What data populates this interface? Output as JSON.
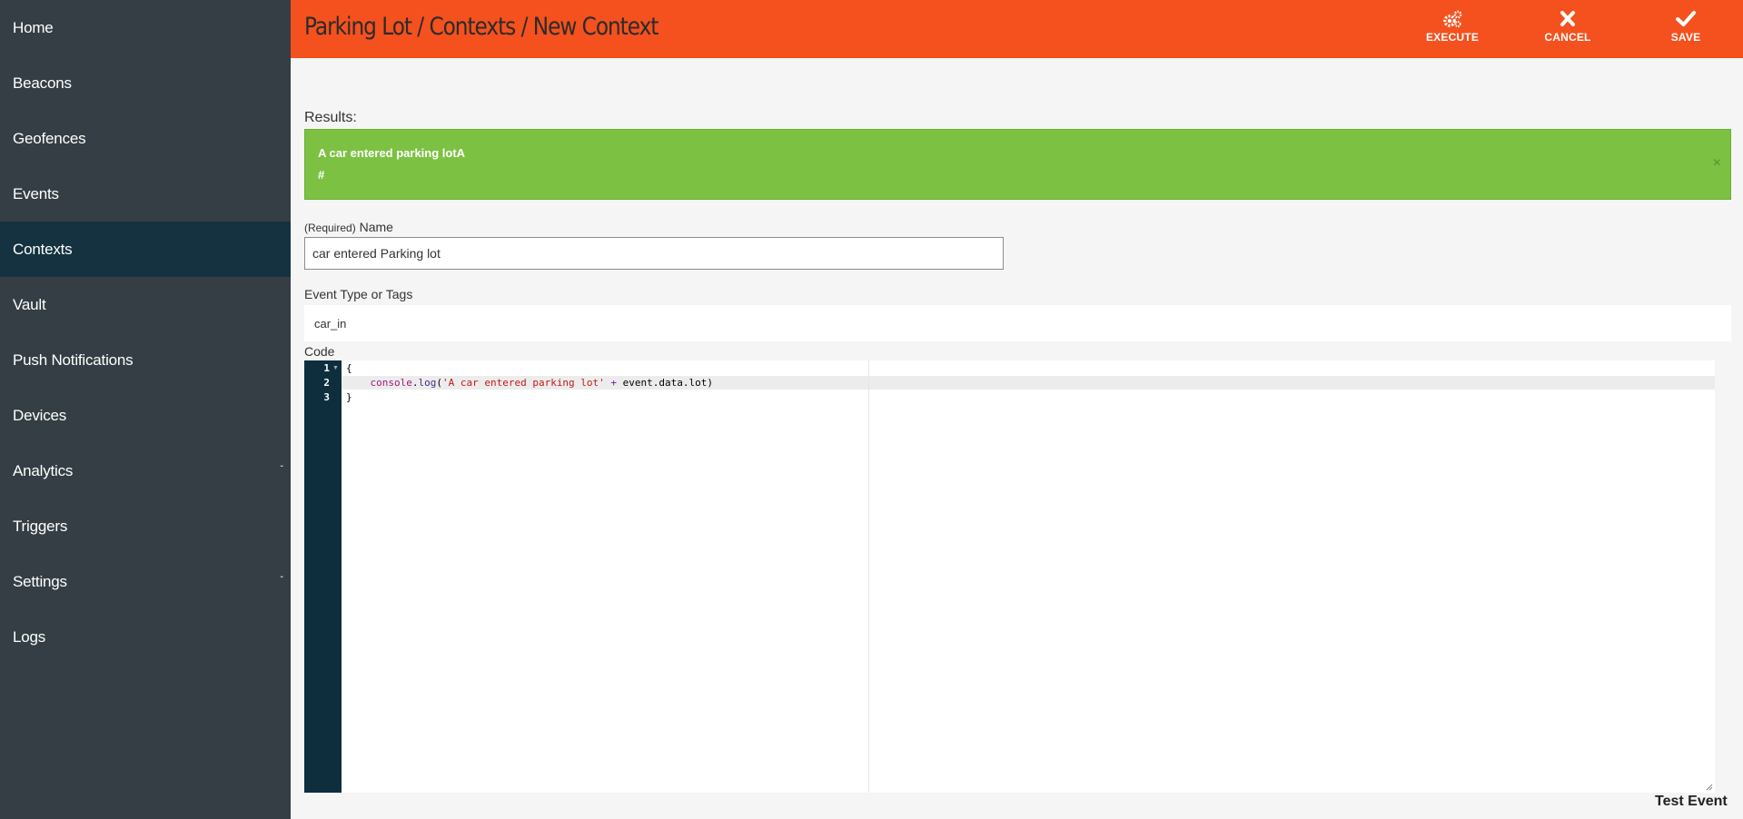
{
  "sidebar": {
    "items": [
      {
        "label": "Home"
      },
      {
        "label": "Beacons"
      },
      {
        "label": "Geofences"
      },
      {
        "label": "Events"
      },
      {
        "label": "Contexts",
        "active": true
      },
      {
        "label": "Vault"
      },
      {
        "label": "Push Notifications"
      },
      {
        "label": "Devices"
      },
      {
        "label": "Analytics",
        "expandable": true
      },
      {
        "label": "Triggers"
      },
      {
        "label": "Settings",
        "expandable": true
      },
      {
        "label": "Logs"
      }
    ]
  },
  "header": {
    "breadcrumb": "Parking Lot / Contexts / New Context",
    "background": "#f4511e",
    "actions": {
      "execute": {
        "label": "EXECUTE",
        "icon": "gears-icon"
      },
      "cancel": {
        "label": "CANCEL",
        "icon": "close-icon"
      },
      "save": {
        "label": "SAVE",
        "icon": "check-icon"
      }
    }
  },
  "results": {
    "label": "Results:",
    "line1": "A car entered parking lotA",
    "line2": "#",
    "close": "×",
    "color": "#7dc142"
  },
  "form": {
    "name_required": "(Required)",
    "name_label": "Name",
    "name_value": "car entered Parking lot",
    "tags_label": "Event Type or Tags",
    "tags_value": "car_in",
    "code_label": "Code"
  },
  "code": {
    "line_numbers": [
      "1",
      "2",
      "3"
    ],
    "line1": "{",
    "line2": {
      "indent": "    ",
      "obj": "console",
      "dot": ".",
      "fn": "log",
      "open": "(",
      "str": "'A car entered parking lot'",
      "op": " + ",
      "rest": "event.data.lot",
      "close": ")"
    },
    "line3": "}"
  },
  "test_event": "Test Event"
}
